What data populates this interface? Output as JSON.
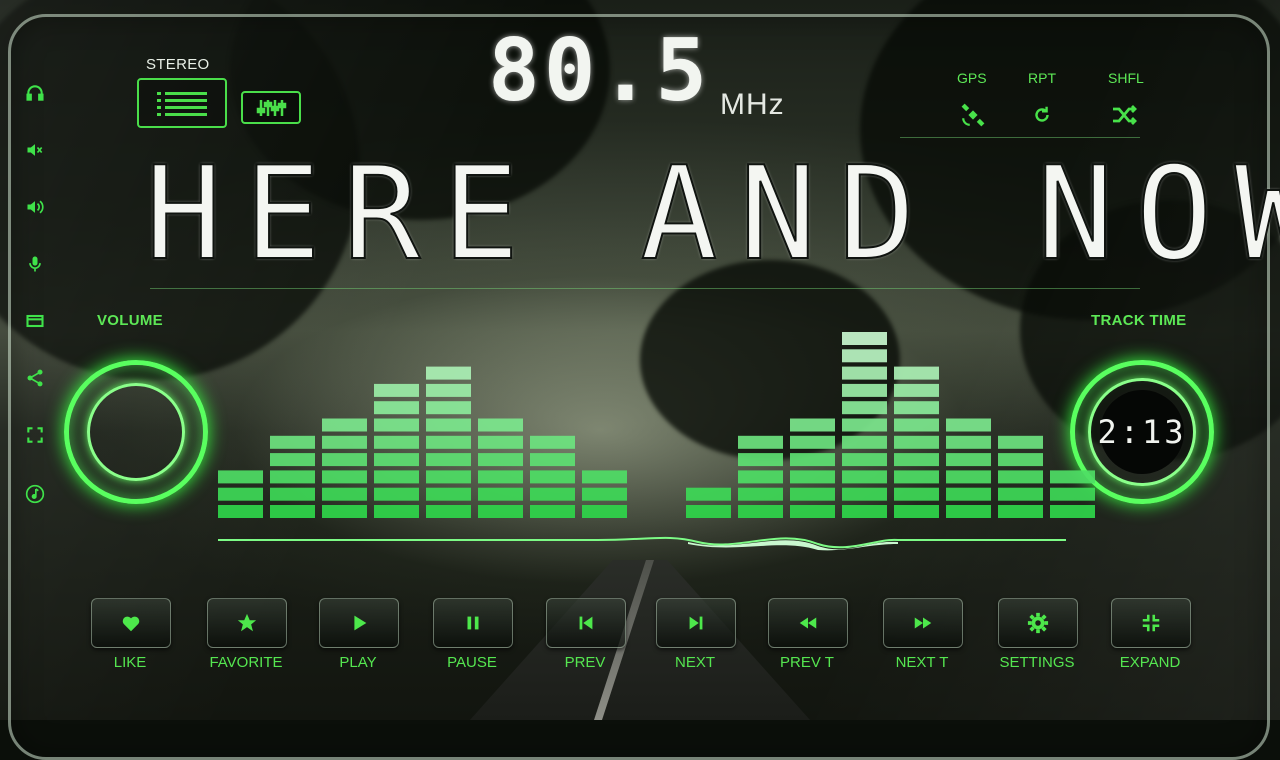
{
  "radio": {
    "stereo_label": "STEREO",
    "frequency": "80.5",
    "unit": "MHz",
    "track_title": "HERE AND NOW"
  },
  "top_right": {
    "gps_label": "GPS",
    "rpt_label": "RPT",
    "shfl_label": "SHFL"
  },
  "volume": {
    "label": "VOLUME"
  },
  "track_time": {
    "label": "TRACK TIME",
    "value": "2:13"
  },
  "sidebar": {
    "icons": [
      "headphones-icon",
      "mute-icon",
      "speaker-icon",
      "microphone-icon",
      "card-icon",
      "share-icon",
      "fullscreen-icon",
      "music-note-icon"
    ]
  },
  "equalizer": {
    "bar_levels": [
      3,
      5,
      6,
      8,
      9,
      6,
      5,
      3,
      0,
      2,
      5,
      6,
      11,
      9,
      6,
      5,
      3
    ],
    "max_level": 11
  },
  "controls": [
    {
      "label": "LIKE",
      "icon": "heart-icon"
    },
    {
      "label": "FAVORITE",
      "icon": "star-icon"
    },
    {
      "label": "PLAY",
      "icon": "play-icon"
    },
    {
      "label": "PAUSE",
      "icon": "pause-icon"
    },
    {
      "label": "PREV",
      "icon": "skip-previous-icon"
    },
    {
      "label": "NEXT",
      "icon": "skip-next-icon"
    },
    {
      "label": "PREV T",
      "icon": "rewind-icon"
    },
    {
      "label": "NEXT T",
      "icon": "fast-forward-icon"
    },
    {
      "label": "SETTINGS",
      "icon": "gear-icon"
    },
    {
      "label": "EXPAND",
      "icon": "collapse-icon"
    }
  ],
  "colors": {
    "accent": "#4ade4a",
    "bar_top": "#c9f7cf",
    "bar_bottom": "#2fd64a",
    "text": "#f2f5f0"
  }
}
